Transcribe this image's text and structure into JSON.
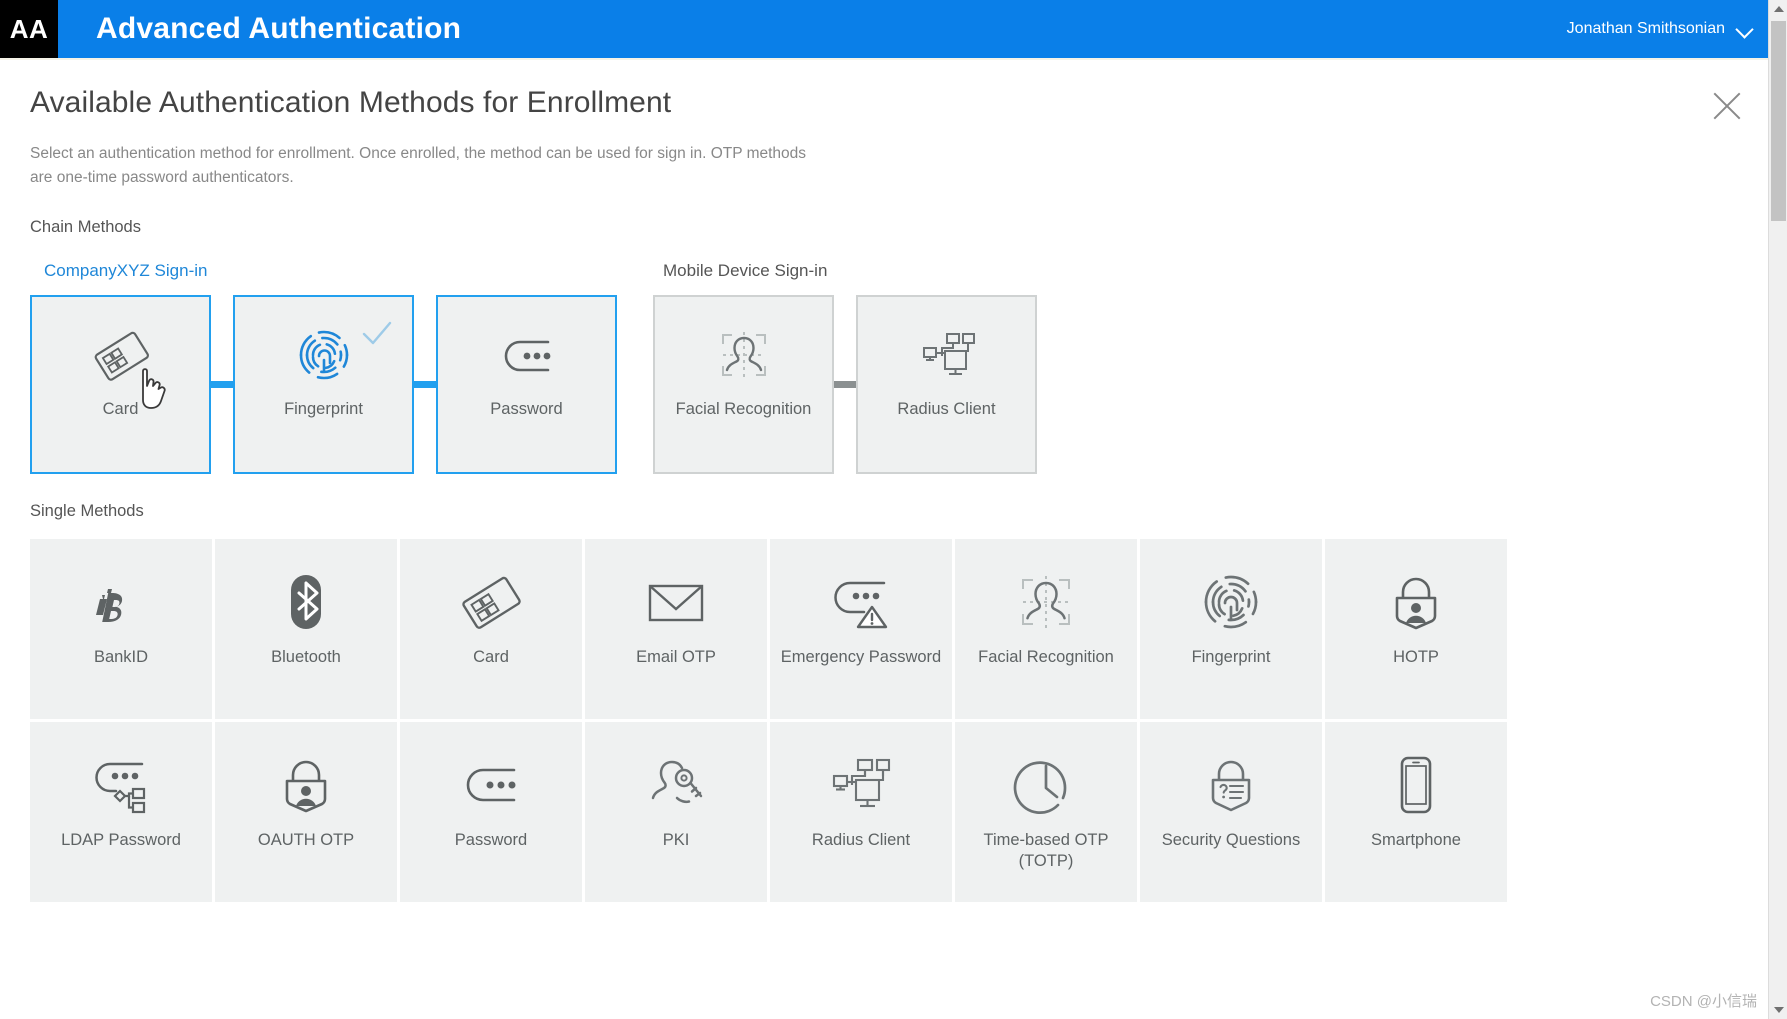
{
  "topbar": {
    "logo": "AA",
    "app_title": "Advanced Authentication",
    "user_name": "Jonathan Smithsonian",
    "chevron_icon": "chevron-down-icon",
    "bg_color": "#0a7fe8"
  },
  "dialog": {
    "title": "Available Authentication Methods for Enrollment",
    "description": "Select an authentication method for enrollment. Once enrolled, the method can be used for sign in. OTP methods are one-time password authenticators.",
    "close_icon": "close-icon"
  },
  "chain_section": {
    "heading": "Chain Methods",
    "chains": [
      {
        "name": "CompanyXYZ Sign-in",
        "selected": true,
        "accent_color": "#22a0ef",
        "steps": [
          {
            "label": "Card",
            "icon": "card-icon",
            "enrolled": false,
            "hovered": true
          },
          {
            "label": "Fingerprint",
            "icon": "fingerprint-icon",
            "enrolled": true,
            "hovered": false
          },
          {
            "label": "Password",
            "icon": "password-icon",
            "enrolled": false,
            "hovered": false
          }
        ]
      },
      {
        "name": "Mobile Device Sign-in",
        "selected": false,
        "accent_color": "#8b9091",
        "steps": [
          {
            "label": "Facial Recognition",
            "icon": "facial-recognition-icon",
            "enrolled": false,
            "hovered": false
          },
          {
            "label": "Radius Client",
            "icon": "radius-client-icon",
            "enrolled": false,
            "hovered": false
          }
        ]
      }
    ]
  },
  "single_section": {
    "heading": "Single Methods",
    "methods": [
      {
        "label": "BankID",
        "icon": "bankid-icon"
      },
      {
        "label": "Bluetooth",
        "icon": "bluetooth-icon"
      },
      {
        "label": "Card",
        "icon": "card-icon"
      },
      {
        "label": "Email OTP",
        "icon": "email-icon"
      },
      {
        "label": "Emergency Password",
        "icon": "emergency-password-icon"
      },
      {
        "label": "Facial Recognition",
        "icon": "facial-recognition-icon"
      },
      {
        "label": "Fingerprint",
        "icon": "fingerprint-icon"
      },
      {
        "label": "HOTP",
        "icon": "lock-user-icon"
      },
      {
        "label": "LDAP Password",
        "icon": "ldap-password-icon"
      },
      {
        "label": "OAUTH OTP",
        "icon": "lock-user-icon"
      },
      {
        "label": "Password",
        "icon": "password-icon"
      },
      {
        "label": "PKI",
        "icon": "pki-key-icon"
      },
      {
        "label": "Radius Client",
        "icon": "radius-client-icon"
      },
      {
        "label": "Time-based OTP (TOTP)",
        "icon": "clock-icon"
      },
      {
        "label": "Security Questions",
        "icon": "security-questions-icon"
      },
      {
        "label": "Smartphone",
        "icon": "smartphone-icon"
      }
    ]
  },
  "watermark": "CSDN @小信瑞"
}
